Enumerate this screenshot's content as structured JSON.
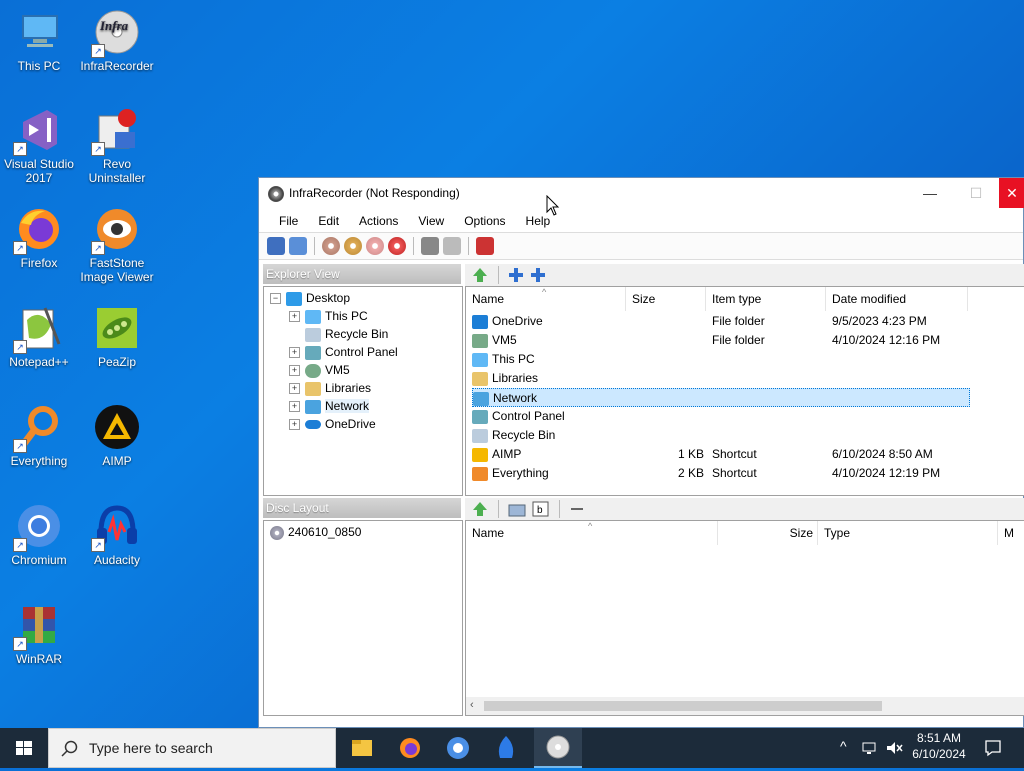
{
  "desktop": {
    "icons": [
      {
        "label": "This PC",
        "icon": "pc-icon"
      },
      {
        "label": "InfraRecorder",
        "icon": "infrarecorder-icon"
      },
      {
        "label": "Visual Studio 2017",
        "icon": "visual-studio-icon"
      },
      {
        "label": "Revo Uninstaller",
        "icon": "revo-uninstaller-icon"
      },
      {
        "label": "Firefox",
        "icon": "firefox-icon"
      },
      {
        "label": "FastStone Image Viewer",
        "icon": "faststone-icon"
      },
      {
        "label": "Notepad++",
        "icon": "notepadpp-icon"
      },
      {
        "label": "PeaZip",
        "icon": "peazip-icon"
      },
      {
        "label": "Everything",
        "icon": "everything-icon"
      },
      {
        "label": "AIMP",
        "icon": "aimp-icon"
      },
      {
        "label": "Chromium",
        "icon": "chromium-icon"
      },
      {
        "label": "Audacity",
        "icon": "audacity-icon"
      },
      {
        "label": "WinRAR",
        "icon": "winrar-icon"
      }
    ]
  },
  "window": {
    "title": "InfraRecorder (Not Responding)",
    "minimize": "—",
    "maximize": "☐",
    "close": "✕",
    "menu": [
      "File",
      "Edit",
      "Actions",
      "View",
      "Options",
      "Help"
    ],
    "explorer_header": "Explorer View",
    "disc_header": "Disc Layout",
    "tree": [
      {
        "label": "Desktop",
        "icon": "desktop-icon",
        "expander": "−"
      },
      {
        "label": "This PC",
        "icon": "pc-icon",
        "expander": "+"
      },
      {
        "label": "Recycle Bin",
        "icon": "recycle-bin-icon",
        "expander": ""
      },
      {
        "label": "Control Panel",
        "icon": "control-panel-icon",
        "expander": "+"
      },
      {
        "label": "VM5",
        "icon": "user-icon",
        "expander": "+"
      },
      {
        "label": "Libraries",
        "icon": "library-icon",
        "expander": "+"
      },
      {
        "label": "Network",
        "icon": "network-icon",
        "expander": "+"
      },
      {
        "label": "OneDrive",
        "icon": "onedrive-icon",
        "expander": "+"
      }
    ],
    "file_columns": [
      "Name",
      "Size",
      "Item type",
      "Date modified"
    ],
    "files": [
      {
        "name": "OneDrive",
        "size": "",
        "type": "File folder",
        "date": "9/5/2023 4:23 PM",
        "icon": "onedrive-icon"
      },
      {
        "name": "VM5",
        "size": "",
        "type": "File folder",
        "date": "4/10/2024 12:16 PM",
        "icon": "user-icon"
      },
      {
        "name": "This PC",
        "size": "",
        "type": "",
        "date": "",
        "icon": "pc-icon"
      },
      {
        "name": "Libraries",
        "size": "",
        "type": "",
        "date": "",
        "icon": "library-icon"
      },
      {
        "name": "Network",
        "size": "",
        "type": "",
        "date": "",
        "icon": "network-icon",
        "selected": true
      },
      {
        "name": "Control Panel",
        "size": "",
        "type": "",
        "date": "",
        "icon": "control-panel-icon"
      },
      {
        "name": "Recycle Bin",
        "size": "",
        "type": "",
        "date": "",
        "icon": "recycle-bin-icon"
      },
      {
        "name": "AIMP",
        "size": "1 KB",
        "type": "Shortcut",
        "date": "6/10/2024 8:50 AM",
        "icon": "aimp-icon"
      },
      {
        "name": "Everything",
        "size": "2 KB",
        "type": "Shortcut",
        "date": "4/10/2024 12:19 PM",
        "icon": "everything-icon"
      }
    ],
    "disc_item": "240610_0850",
    "disc_columns": [
      "Name",
      "Size",
      "Type",
      "M"
    ]
  },
  "taskbar": {
    "search_placeholder": "Type here to search",
    "time": "8:51 AM",
    "date": "6/10/2024",
    "apps": [
      "file-explorer-icon",
      "firefox-icon",
      "chromium-icon",
      "app-icon",
      "infrarecorder-icon"
    ]
  },
  "colors": {
    "accent": "#0078d7",
    "close": "#e81123",
    "selection": "#cce8ff"
  }
}
